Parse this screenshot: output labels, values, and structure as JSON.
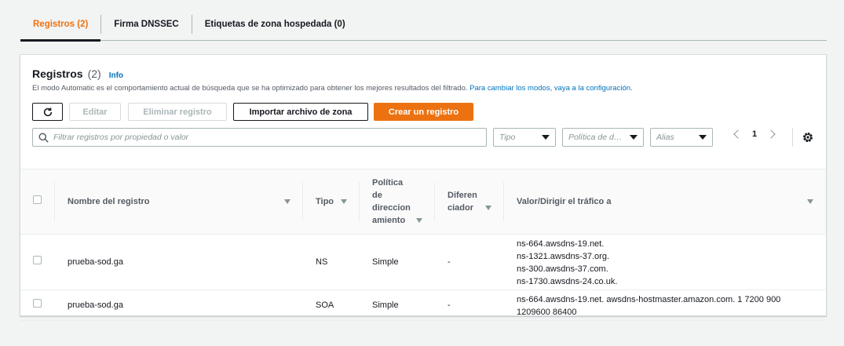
{
  "tabs": [
    {
      "label": "Registros (2)",
      "active": true
    },
    {
      "label": "Firma DNSSEC",
      "active": false
    },
    {
      "label": "Etiquetas de zona hospedada (0)",
      "active": false
    }
  ],
  "header": {
    "title": "Registros",
    "count": "(2)",
    "info": "Info",
    "description": "El modo Automatic es el comportamiento actual de búsqueda que se ha optimizado para obtener los mejores resultados del filtrado.",
    "link": "Para cambiar los modos, vaya a la configuración."
  },
  "toolbar": {
    "edit": "Editar",
    "delete": "Eliminar registro",
    "import": "Importar archivo de zona",
    "create": "Crear un registro"
  },
  "filters": {
    "search_placeholder": "Filtrar registros por propiedad o valor",
    "type": "Tipo",
    "policy": "Política de d…",
    "alias": "Alias"
  },
  "pagination": {
    "page": "1"
  },
  "table": {
    "columns": {
      "name": "Nombre del registro",
      "type": "Tipo",
      "policy": "Política de direccion amiento",
      "diff": "Diferen ciador",
      "value": "Valor/Dirigir el tráfico a"
    },
    "rows": [
      {
        "name": "prueba-sod.ga",
        "type": "NS",
        "policy": "Simple",
        "diff": "-",
        "values": [
          "ns-664.awsdns-19.net.",
          "ns-1321.awsdns-37.org.",
          "ns-300.awsdns-37.com.",
          "ns-1730.awsdns-24.co.uk."
        ]
      },
      {
        "name": "prueba-sod.ga",
        "type": "SOA",
        "policy": "Simple",
        "diff": "-",
        "values": [
          "ns-664.awsdns-19.net. awsdns-hostmaster.amazon.com. 1 7200 900",
          "1209600 86400"
        ]
      }
    ]
  },
  "colors": {
    "accent": "#ec7211",
    "link": "#0073bb"
  }
}
